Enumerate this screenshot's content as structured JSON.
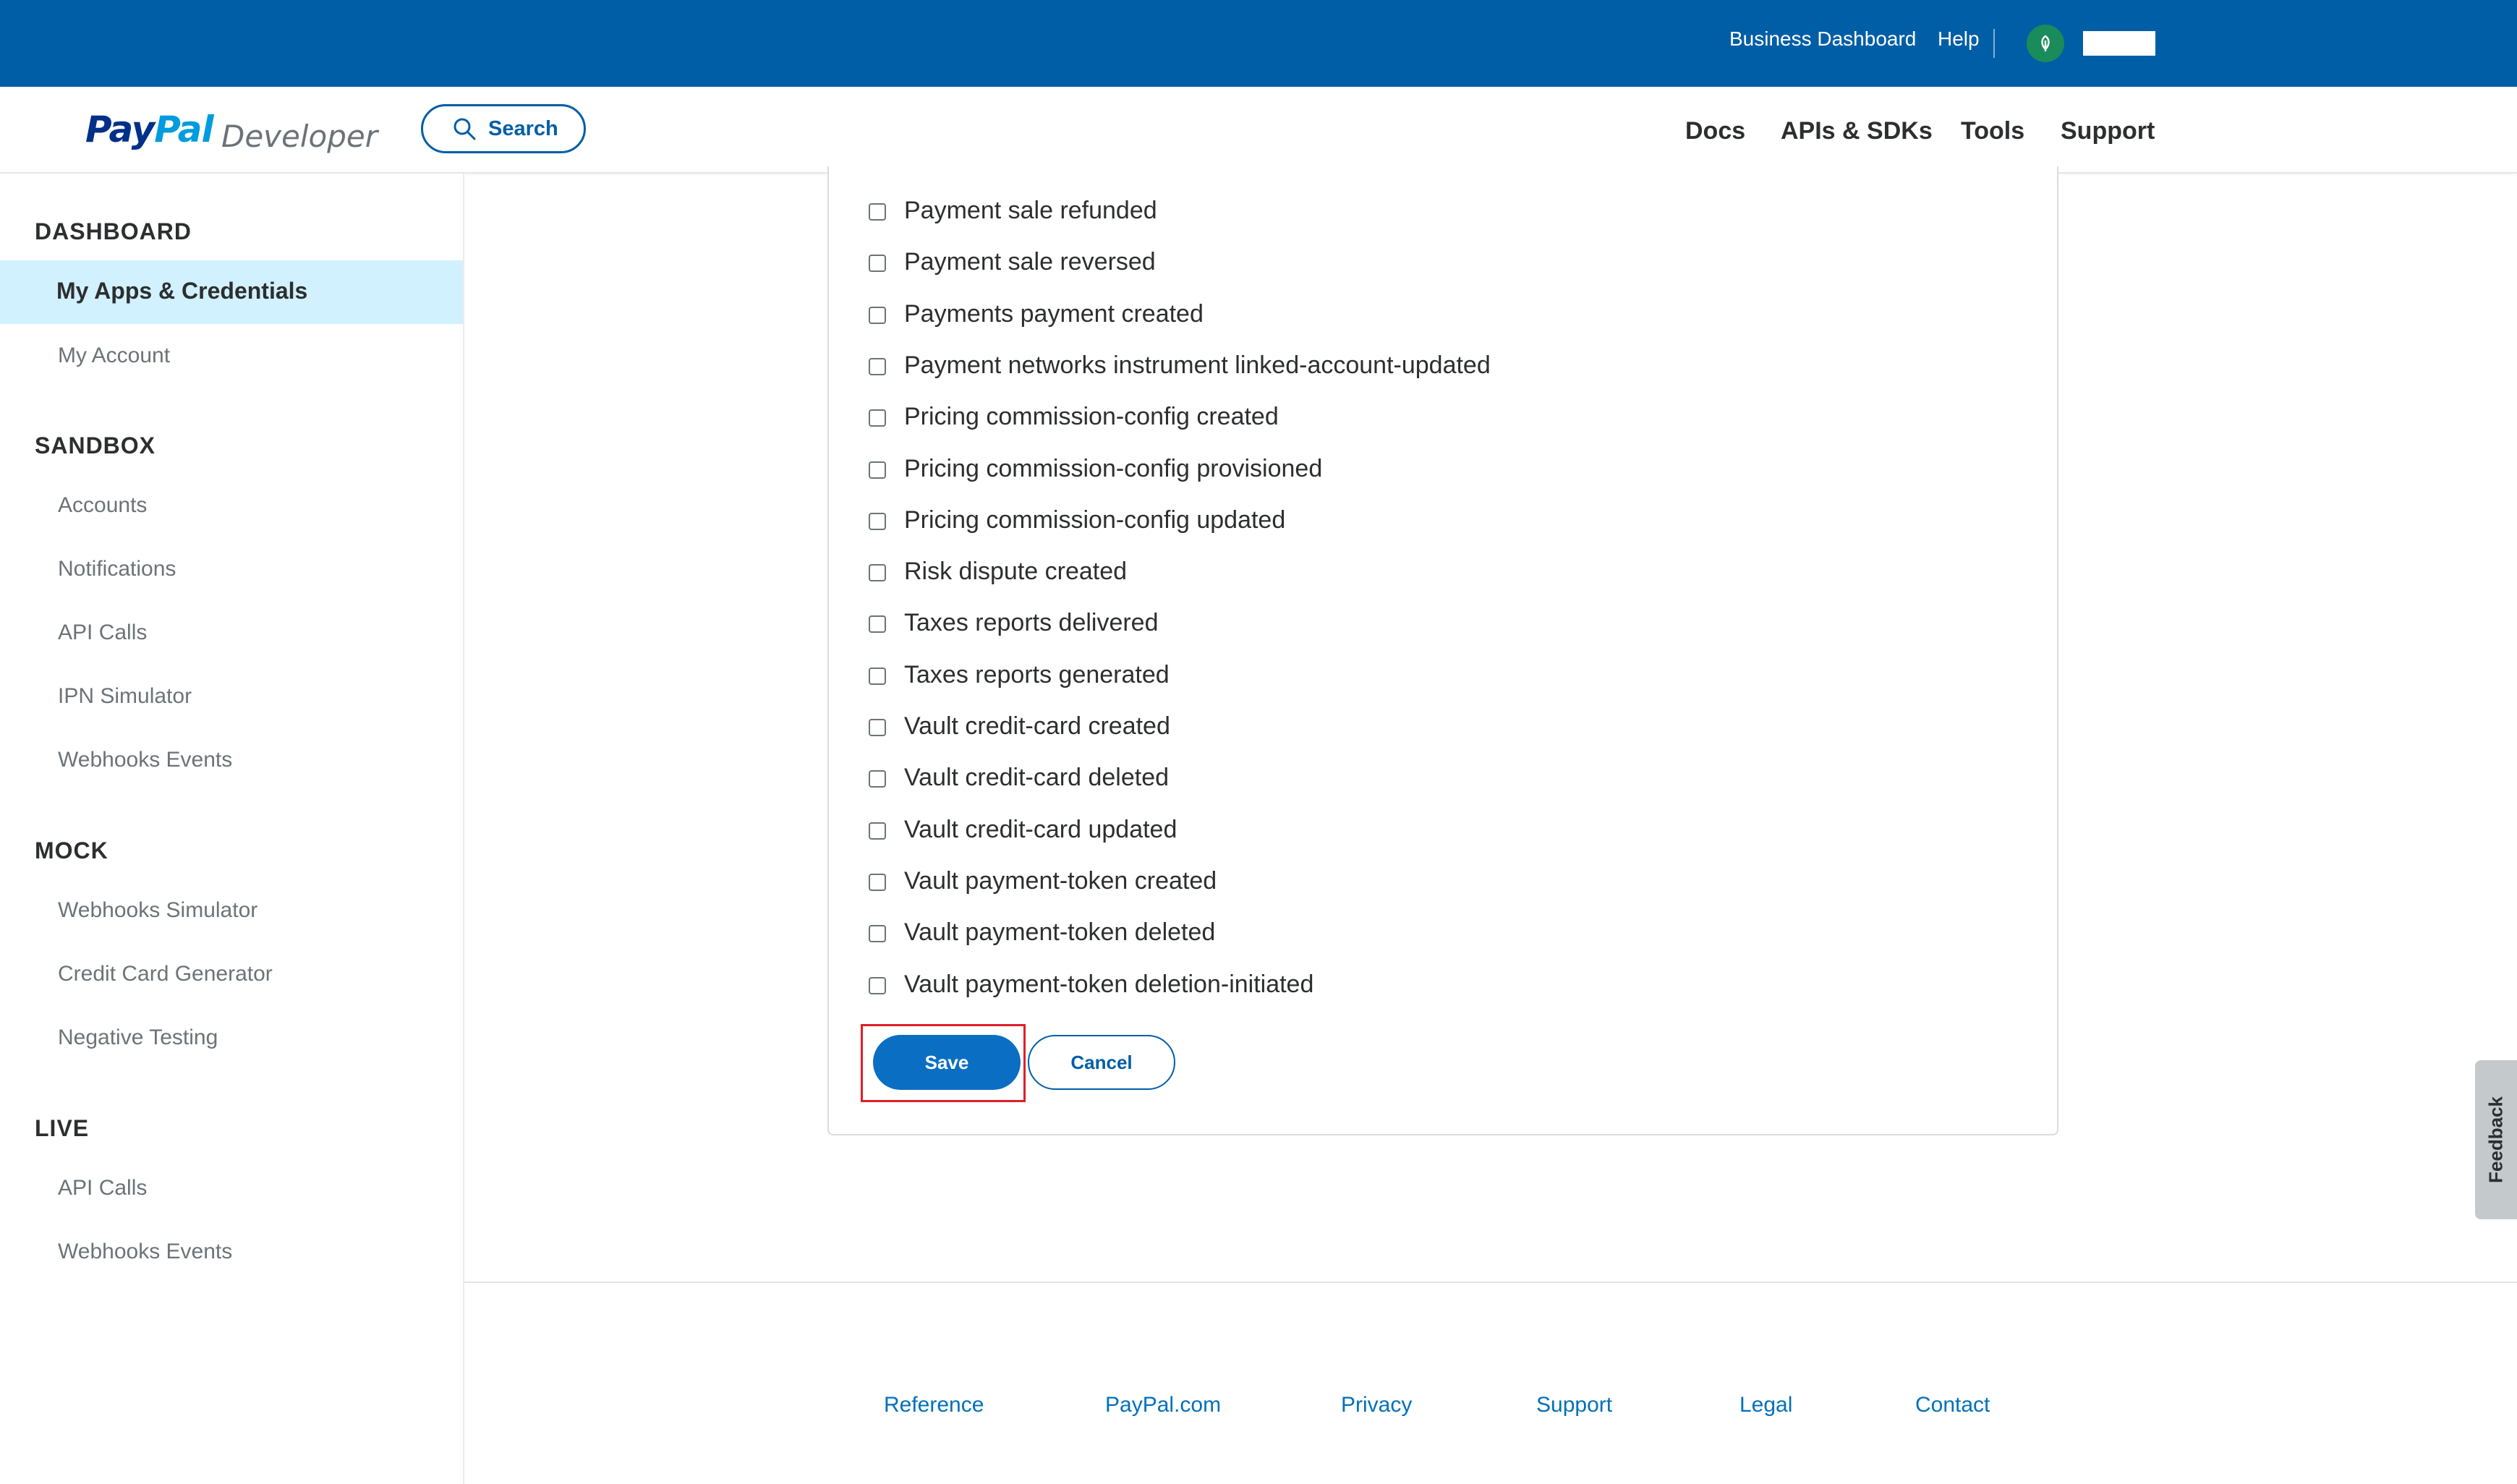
{
  "topbar": {
    "links": [
      "Business Dashboard",
      "Help"
    ],
    "avatar_icon": "leaf-icon",
    "bg_color": "#005ea6"
  },
  "header": {
    "logo_pay": "Pay",
    "logo_pal": "Pal",
    "logo_sub": "Developer",
    "search_label": "Search",
    "nav": [
      "Docs",
      "APIs & SDKs",
      "Tools",
      "Support"
    ]
  },
  "sidebar": {
    "sections": [
      {
        "heading": "DASHBOARD",
        "items": [
          "My Apps & Credentials",
          "My Account"
        ]
      },
      {
        "heading": "SANDBOX",
        "items": [
          "Accounts",
          "Notifications",
          "API Calls",
          "IPN Simulator",
          "Webhooks Events"
        ]
      },
      {
        "heading": "MOCK",
        "items": [
          "Webhooks Simulator",
          "Credit Card Generator",
          "Negative Testing"
        ]
      },
      {
        "heading": "LIVE",
        "items": [
          "API Calls",
          "Webhooks Events"
        ]
      }
    ],
    "active_item": "My Apps & Credentials",
    "active_color": "#d1f1ff"
  },
  "events": {
    "items": [
      {
        "label": "Payment sale refunded",
        "checked": false
      },
      {
        "label": "Payment sale reversed",
        "checked": false
      },
      {
        "label": "Payments payment created",
        "checked": false
      },
      {
        "label": "Payment networks instrument linked-account-updated",
        "checked": false
      },
      {
        "label": "Pricing commission-config created",
        "checked": false
      },
      {
        "label": "Pricing commission-config provisioned",
        "checked": false
      },
      {
        "label": "Pricing commission-config updated",
        "checked": false
      },
      {
        "label": "Risk dispute created",
        "checked": false
      },
      {
        "label": "Taxes reports delivered",
        "checked": false
      },
      {
        "label": "Taxes reports generated",
        "checked": false
      },
      {
        "label": "Vault credit-card created",
        "checked": false
      },
      {
        "label": "Vault credit-card deleted",
        "checked": false
      },
      {
        "label": "Vault credit-card updated",
        "checked": false
      },
      {
        "label": "Vault payment-token created",
        "checked": false
      },
      {
        "label": "Vault payment-token deleted",
        "checked": false
      },
      {
        "label": "Vault payment-token deletion-initiated",
        "checked": false
      }
    ],
    "save_label": "Save",
    "cancel_label": "Cancel",
    "highlight_color": "#e01f26"
  },
  "footer": {
    "links": [
      "Reference",
      "PayPal.com",
      "Privacy",
      "Support",
      "Legal",
      "Contact"
    ]
  },
  "feedback_label": "Feedback"
}
